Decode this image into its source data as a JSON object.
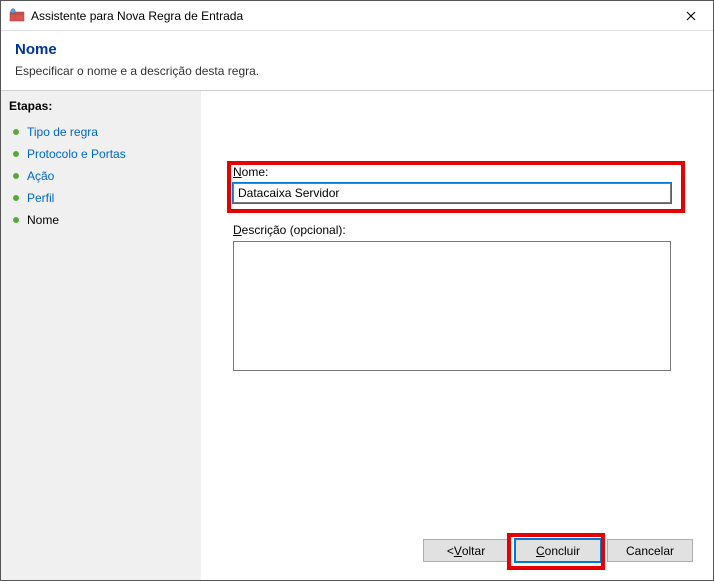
{
  "window": {
    "title": "Assistente para Nova Regra de Entrada"
  },
  "header": {
    "title": "Nome",
    "subtitle": "Especificar o nome e a descrição desta regra."
  },
  "sidebar": {
    "heading": "Etapas:",
    "items": [
      {
        "label": "Tipo de regra"
      },
      {
        "label": "Protocolo e Portas"
      },
      {
        "label": "Ação"
      },
      {
        "label": "Perfil"
      },
      {
        "label": "Nome"
      }
    ]
  },
  "form": {
    "name_label_prefix": "N",
    "name_label_rest": "ome:",
    "name_value": "Datacaixa Servidor",
    "desc_label_prefix": "D",
    "desc_label_rest": "escrição (opcional):",
    "desc_value": ""
  },
  "buttons": {
    "back_prefix": "<",
    "back_ul": " V",
    "back_rest": "oltar",
    "finish_ul": "C",
    "finish_rest": "oncluir",
    "cancel": "Cancelar"
  }
}
